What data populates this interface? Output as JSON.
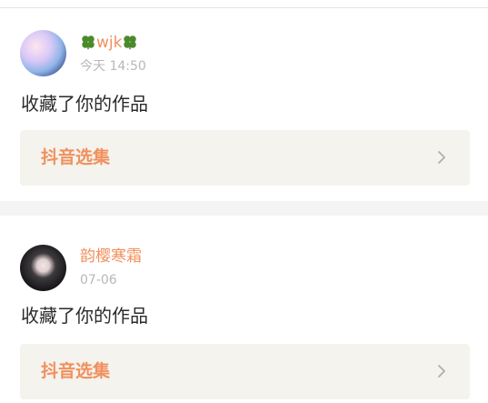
{
  "notifications": [
    {
      "user": "wjk",
      "time": "今天 14:50",
      "message": "收藏了你的作品",
      "target": "抖音选集"
    },
    {
      "user": "韵樱寒霜",
      "time": "07-06",
      "message": "收藏了你的作品",
      "target": "抖音选集"
    }
  ],
  "colors": {
    "accent": "#f1905d",
    "clover": "#4a8a2b",
    "box_bg": "#f4f3ee"
  }
}
